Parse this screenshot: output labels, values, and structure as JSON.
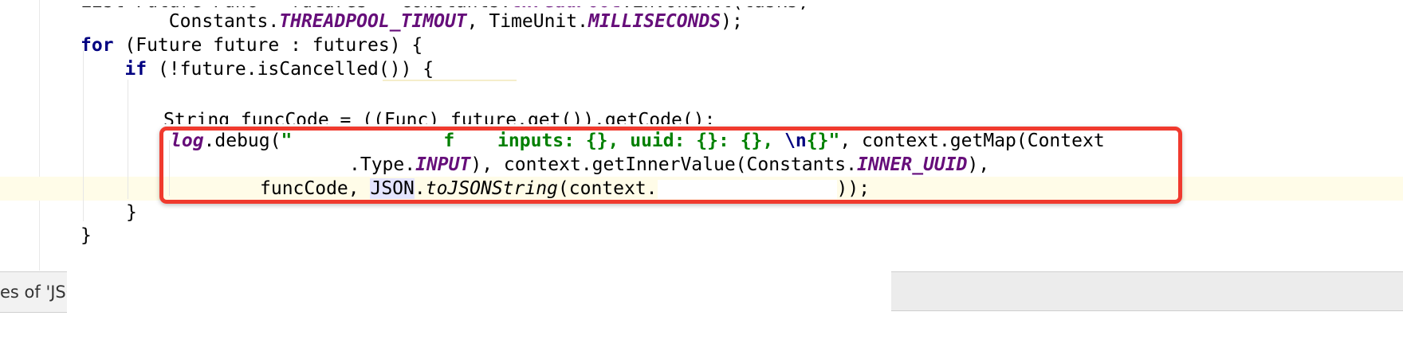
{
  "editor": {
    "line0": {
      "pre": "List<Future<Func>> futures = Constants.",
      "field": "threadPool",
      "post": ".invokeAll(tasks,"
    },
    "line1": {
      "indent": "        Constants.",
      "field1": "THREADPOOL_TIMOUT",
      "mid": ", TimeUnit.",
      "field2": "MILLISECONDS",
      "post": ");"
    },
    "line2": {
      "kw": "for",
      "post": " (Future future : futures) {"
    },
    "line3": {
      "indent": "    ",
      "kw": "if",
      "post": " (!future.isCancelled()) {"
    },
    "line4_partial": "String funcCode = ((Func) future.get()).getCode();",
    "line5": {
      "field": "log",
      "pre": ".debug(",
      "str_open": "\"",
      "str_frag": "f",
      "str_rest": " inputs: {}, uuid: {}: {}, ",
      "escape": "\\n",
      "str_close": "{}\"",
      "post": ", context.getMap(Context"
    },
    "line6": {
      "pre": ".Type.",
      "field1": "INPUT",
      "mid": "), context.getInnerValue(Constants.",
      "field2": "INNER_UUID",
      "post": "),"
    },
    "line7": {
      "pre": "funcCode, ",
      "json": "JSON",
      "dot": ".",
      "method": "toJSONString",
      "mid": "(context.",
      "post": "));"
    },
    "line8": "}",
    "line9": "}"
  },
  "bottom_panel": {
    "tab_label": "es of 'JSO"
  },
  "colors": {
    "keyword": "#000080",
    "field": "#660e7a",
    "string": "#008000",
    "highlight_border": "#f03a2e"
  }
}
